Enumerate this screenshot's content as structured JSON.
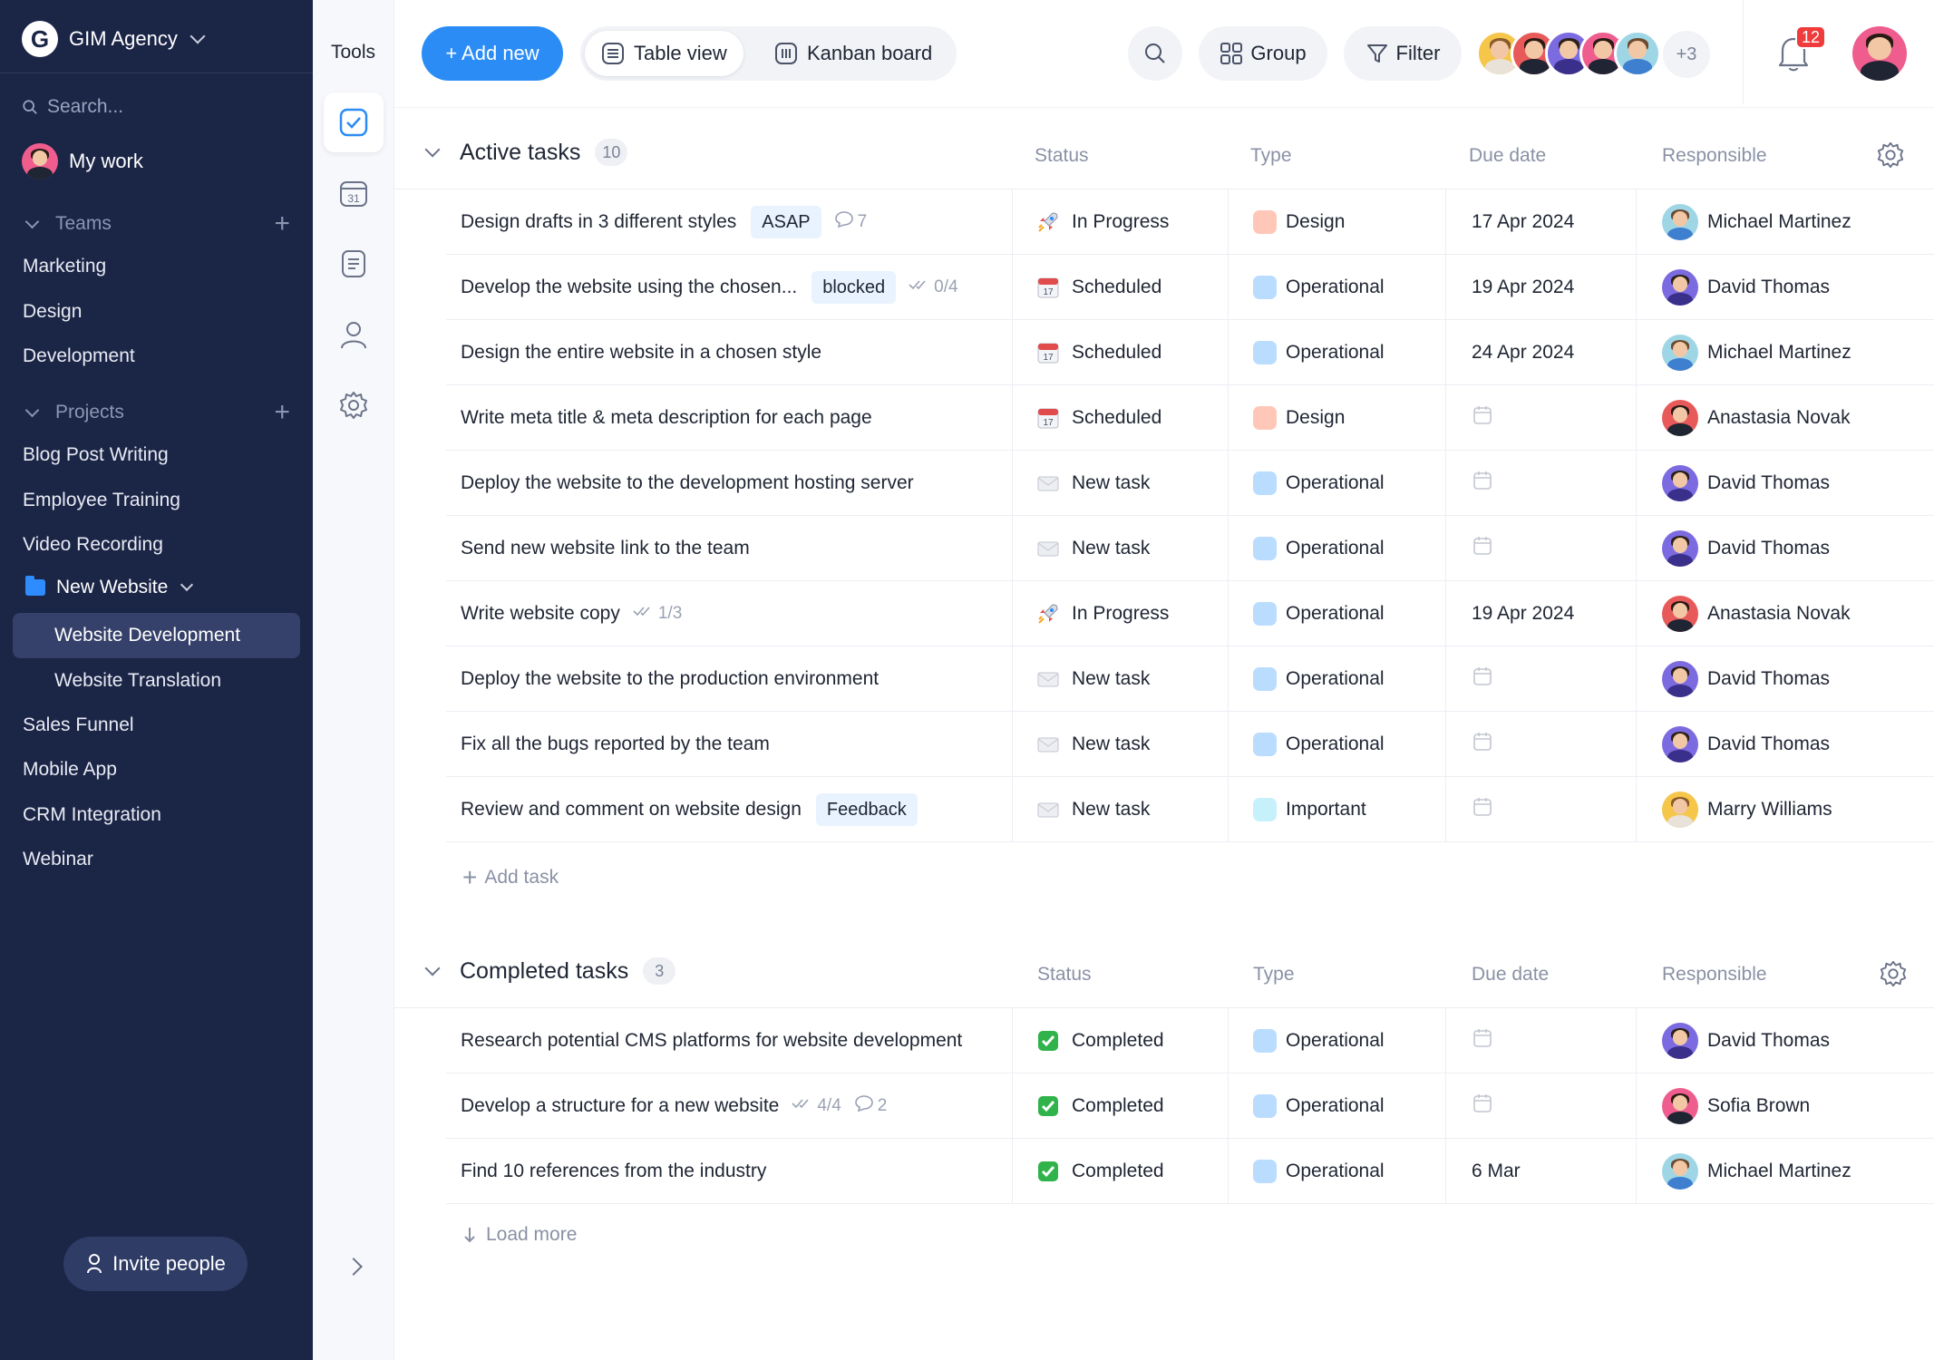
{
  "workspace": {
    "name": "GIM Agency",
    "logo_letter": "G"
  },
  "search": {
    "placeholder": "Search..."
  },
  "my_work": {
    "label": "My work"
  },
  "teams": {
    "label": "Teams",
    "items": [
      "Marketing",
      "Design",
      "Development"
    ]
  },
  "projects": {
    "label": "Projects",
    "items": [
      "Blog Post Writing",
      "Employee Training",
      "Video Recording"
    ],
    "folder": {
      "label": "New Website",
      "children": [
        "Website Development",
        "Website Translation"
      ]
    },
    "items_after": [
      "Sales Funnel",
      "Mobile App",
      "CRM Integration",
      "Webinar"
    ]
  },
  "invite": {
    "label": "Invite people"
  },
  "tools": {
    "title": "Tools",
    "icons": [
      "tasks-icon",
      "calendar-icon",
      "notes-icon",
      "contacts-icon",
      "settings-icon"
    ],
    "calendar_day": "31"
  },
  "toolbar": {
    "add_new": "+ Add new",
    "table_view": "Table view",
    "kanban_board": "Kanban board",
    "group": "Group",
    "filter": "Filter",
    "more_members": "+3",
    "notifications": "12"
  },
  "columns": {
    "status": "Status",
    "type": "Type",
    "due": "Due date",
    "responsible": "Responsible"
  },
  "active": {
    "title": "Active tasks",
    "count": "10",
    "rows": [
      {
        "name": "Design drafts in 3 different styles",
        "tag": "ASAP",
        "meta": "7",
        "meta_icon": "comment",
        "status": "In Progress",
        "status_icon": "rocket",
        "type": "Design",
        "type_color": "#ffc7b8",
        "due": "17 Apr 2024",
        "resp": "Michael Martinez",
        "resp_av": "mm"
      },
      {
        "name": "Develop the website using the chosen...",
        "tag": "blocked",
        "meta": "0/4",
        "meta_icon": "check",
        "status": "Scheduled",
        "status_icon": "calendar",
        "type": "Operational",
        "type_color": "#b9dcff",
        "due": "19 Apr 2024",
        "resp": "David Thomas",
        "resp_av": "dt"
      },
      {
        "name": "Design the entire website in a chosen style",
        "tag": "",
        "meta": "",
        "meta_icon": "",
        "status": "Scheduled",
        "status_icon": "calendar",
        "type": "Operational",
        "type_color": "#b9dcff",
        "due": "24 Apr 2024",
        "resp": "Michael Martinez",
        "resp_av": "mm"
      },
      {
        "name": "Write meta title & meta description for each page",
        "tag": "",
        "meta": "",
        "meta_icon": "",
        "status": "Scheduled",
        "status_icon": "calendar",
        "type": "Design",
        "type_color": "#ffc7b8",
        "due": "",
        "resp": "Anastasia Novak",
        "resp_av": "an"
      },
      {
        "name": "Deploy the website to the development hosting server",
        "tag": "",
        "meta": "",
        "meta_icon": "",
        "status": "New task",
        "status_icon": "envelope",
        "type": "Operational",
        "type_color": "#b9dcff",
        "due": "",
        "resp": "David Thomas",
        "resp_av": "dt"
      },
      {
        "name": "Send new website link to the team",
        "tag": "",
        "meta": "",
        "meta_icon": "",
        "status": "New task",
        "status_icon": "envelope",
        "type": "Operational",
        "type_color": "#b9dcff",
        "due": "",
        "resp": "David Thomas",
        "resp_av": "dt"
      },
      {
        "name": "Write website copy",
        "tag": "",
        "meta": "1/3",
        "meta_icon": "check",
        "status": "In Progress",
        "status_icon": "rocket",
        "type": "Operational",
        "type_color": "#b9dcff",
        "due": "19 Apr 2024",
        "resp": "Anastasia Novak",
        "resp_av": "an"
      },
      {
        "name": "Deploy the website to the production environment",
        "tag": "",
        "meta": "",
        "meta_icon": "",
        "status": "New task",
        "status_icon": "envelope",
        "type": "Operational",
        "type_color": "#b9dcff",
        "due": "",
        "resp": "David Thomas",
        "resp_av": "dt"
      },
      {
        "name": "Fix all the bugs reported by the team",
        "tag": "",
        "meta": "",
        "meta_icon": "",
        "status": "New task",
        "status_icon": "envelope",
        "type": "Operational",
        "type_color": "#b9dcff",
        "due": "",
        "resp": "David Thomas",
        "resp_av": "dt"
      },
      {
        "name": "Review and comment on website design",
        "tag": "Feedback",
        "meta": "",
        "meta_icon": "",
        "status": "New task",
        "status_icon": "envelope",
        "type": "Important",
        "type_color": "#c6f1fb",
        "due": "",
        "resp": "Marry Williams",
        "resp_av": "mw"
      }
    ],
    "add_task": "Add task"
  },
  "completed": {
    "title": "Completed tasks",
    "count": "3",
    "rows": [
      {
        "name": "Research potential CMS platforms for website development",
        "tag": "",
        "meta": "",
        "meta_icon": "",
        "meta2": "",
        "status": "Completed",
        "status_icon": "checkbox",
        "type": "Operational",
        "type_color": "#b9dcff",
        "due": "",
        "resp": "David Thomas",
        "resp_av": "dt"
      },
      {
        "name": "Develop a structure for a new website",
        "tag": "",
        "meta": "4/4",
        "meta_icon": "check",
        "meta2": "2",
        "status": "Completed",
        "status_icon": "checkbox",
        "type": "Operational",
        "type_color": "#b9dcff",
        "due": "",
        "resp": "Sofia Brown",
        "resp_av": "sb"
      },
      {
        "name": "Find 10 references from the industry",
        "tag": "",
        "meta": "",
        "meta_icon": "",
        "meta2": "",
        "status": "Completed",
        "status_icon": "checkbox",
        "type": "Operational",
        "type_color": "#b9dcff",
        "due": "6 Mar",
        "resp": "Michael Martinez",
        "resp_av": "mm"
      }
    ],
    "load_more": "Load more"
  },
  "avatars": {
    "mm": {
      "bg": "#9fd6e6",
      "hair": "#6b4a2f",
      "shirt": "#3f7fd0"
    },
    "dt": {
      "bg": "#7b6ae0",
      "hair": "#2b2118",
      "shirt": "#3a2f8a"
    },
    "an": {
      "bg": "#e85a5a",
      "hair": "#2a1a14",
      "shirt": "#1f2533"
    },
    "mw": {
      "bg": "#f5c64a",
      "hair": "#8a5a2b",
      "shirt": "#e8e2d8"
    },
    "sb": {
      "bg": "#ef5d8e",
      "hair": "#2a1a14",
      "shirt": "#1f2533"
    },
    "me": {
      "bg": "#ef5d8e",
      "hair": "#2a1a14",
      "shirt": "#1f2533"
    }
  },
  "colors": {
    "sidebar": "#1b2546",
    "accent": "#2b8cf5",
    "badge": "#ef3b3b"
  }
}
